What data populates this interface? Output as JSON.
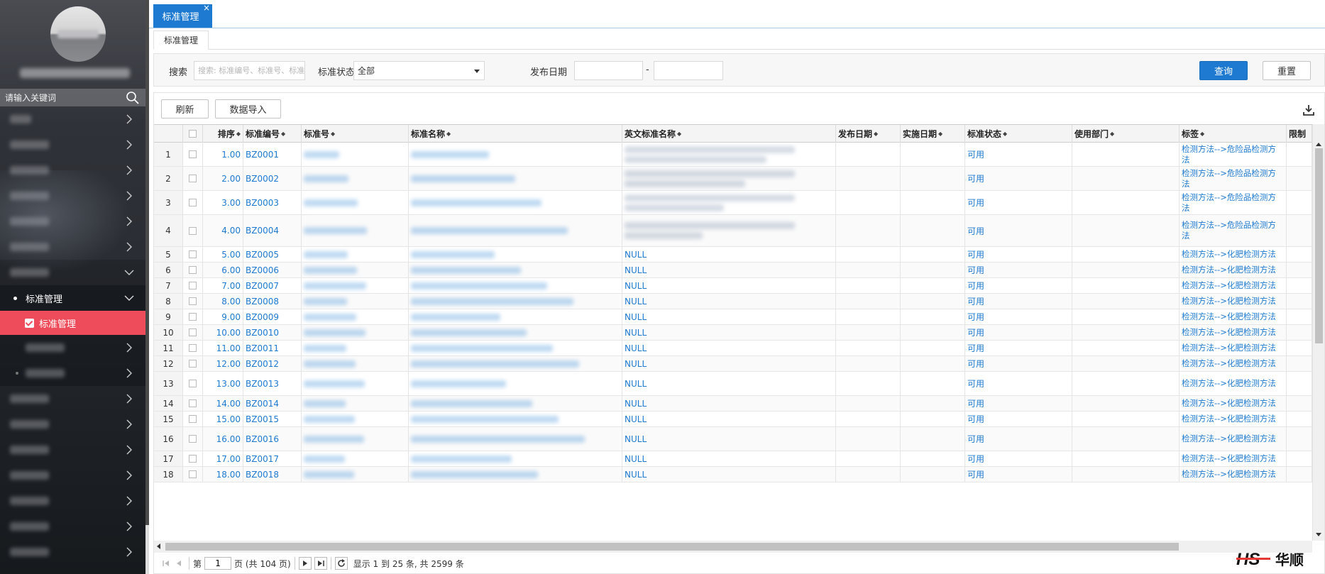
{
  "sidebar": {
    "search_placeholder": "请输入关键词",
    "section_label": "标准管理",
    "active_label": "标准管理"
  },
  "tabs": {
    "top_tab": "标准管理",
    "sub_tab": "标准管理"
  },
  "filters": {
    "search_label": "搜索",
    "search_placeholder": "搜索: 标准编号、标准号、标准名称",
    "status_label": "标准状态",
    "status_value": "全部",
    "date_label": "发布日期",
    "date_sep": "-",
    "query_button": "查询",
    "reset_button": "重置"
  },
  "toolbar": {
    "refresh_button": "刷新",
    "import_button": "数据导入"
  },
  "table": {
    "headers": {
      "order": "排序",
      "code": "标准编号",
      "number": "标准号",
      "name": "标准名称",
      "en_name": "英文标准名称",
      "publish_date": "发布日期",
      "impl_date": "实施日期",
      "status": "标准状态",
      "dept": "使用部门",
      "tags": "标签",
      "limit": "限制"
    },
    "rows": [
      {
        "idx": "1",
        "order": "1.00",
        "code": "BZ0001",
        "en": "",
        "status": "可用",
        "tag": "检测方法-->危险品检测方法"
      },
      {
        "idx": "2",
        "order": "2.00",
        "code": "BZ0002",
        "en": "",
        "status": "可用",
        "tag": "检测方法-->危险品检测方法"
      },
      {
        "idx": "3",
        "order": "3.00",
        "code": "BZ0003",
        "en": "",
        "status": "可用",
        "tag": "检测方法-->危险品检测方法"
      },
      {
        "idx": "4",
        "order": "4.00",
        "code": "BZ0004",
        "en": "",
        "status": "可用",
        "tag": "检测方法-->危险品检测方法"
      },
      {
        "idx": "5",
        "order": "5.00",
        "code": "BZ0005",
        "en": "NULL",
        "status": "可用",
        "tag": "检测方法-->化肥检测方法"
      },
      {
        "idx": "6",
        "order": "6.00",
        "code": "BZ0006",
        "en": "NULL",
        "status": "可用",
        "tag": "检测方法-->化肥检测方法"
      },
      {
        "idx": "7",
        "order": "7.00",
        "code": "BZ0007",
        "en": "NULL",
        "status": "可用",
        "tag": "检测方法-->化肥检测方法"
      },
      {
        "idx": "8",
        "order": "8.00",
        "code": "BZ0008",
        "en": "NULL",
        "status": "可用",
        "tag": "检测方法-->化肥检测方法"
      },
      {
        "idx": "9",
        "order": "9.00",
        "code": "BZ0009",
        "en": "NULL",
        "status": "可用",
        "tag": "检测方法-->化肥检测方法"
      },
      {
        "idx": "10",
        "order": "10.00",
        "code": "BZ0010",
        "en": "NULL",
        "status": "可用",
        "tag": "检测方法-->化肥检测方法"
      },
      {
        "idx": "11",
        "order": "11.00",
        "code": "BZ0011",
        "en": "NULL",
        "status": "可用",
        "tag": "检测方法-->化肥检测方法"
      },
      {
        "idx": "12",
        "order": "12.00",
        "code": "BZ0012",
        "en": "NULL",
        "status": "可用",
        "tag": "检测方法-->化肥检测方法"
      },
      {
        "idx": "13",
        "order": "13.00",
        "code": "BZ0013",
        "en": "NULL",
        "status": "可用",
        "tag": "检测方法-->化肥检测方法"
      },
      {
        "idx": "14",
        "order": "14.00",
        "code": "BZ0014",
        "en": "NULL",
        "status": "可用",
        "tag": "检测方法-->化肥检测方法"
      },
      {
        "idx": "15",
        "order": "15.00",
        "code": "BZ0015",
        "en": "NULL",
        "status": "可用",
        "tag": "检测方法-->化肥检测方法"
      },
      {
        "idx": "16",
        "order": "16.00",
        "code": "BZ0016",
        "en": "NULL",
        "status": "可用",
        "tag": "检测方法-->化肥检测方法"
      },
      {
        "idx": "17",
        "order": "17.00",
        "code": "BZ0017",
        "en": "NULL",
        "status": "可用",
        "tag": "检测方法-->化肥检测方法"
      },
      {
        "idx": "18",
        "order": "18.00",
        "code": "BZ0018",
        "en": "NULL",
        "status": "可用",
        "tag": "检测方法-->化肥检测方法"
      }
    ]
  },
  "pager": {
    "page_prefix": "第",
    "page_value": "1",
    "page_suffix": "页 (共 104 页)",
    "summary": "显示 1 到 25 条, 共 2599 条"
  },
  "logo": {
    "text": "华顺",
    "mark": "HS"
  },
  "colors": {
    "primary": "#1e7ad0",
    "active_menu": "#ee4c5a"
  },
  "icons": [
    "search-icon",
    "chevron-right-icon",
    "chevron-down-icon",
    "check-icon",
    "download-icon",
    "refresh-icon",
    "first-page-icon",
    "prev-page-icon",
    "next-page-icon",
    "last-page-icon"
  ]
}
